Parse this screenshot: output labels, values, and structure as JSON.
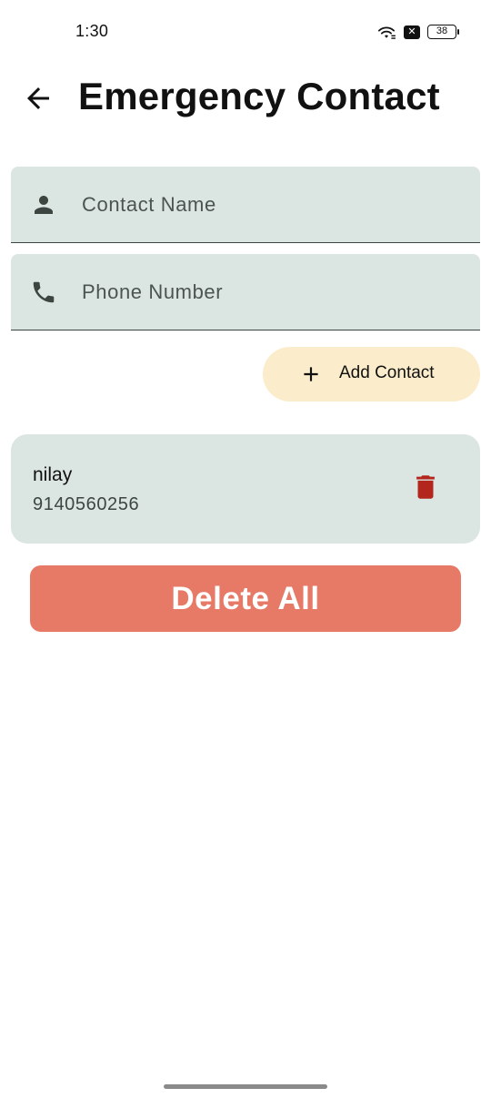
{
  "status_bar": {
    "time": "1:30",
    "battery": "38"
  },
  "header": {
    "title": "Emergency Contact",
    "back_icon": "arrow-back-icon"
  },
  "form": {
    "name_field": {
      "placeholder": "Contact Name",
      "value": "",
      "icon": "person-icon"
    },
    "phone_field": {
      "placeholder": "Phone Number",
      "value": "",
      "icon": "phone-icon"
    },
    "add_button": {
      "label": "Add Contact",
      "icon": "plus-icon"
    }
  },
  "contacts": [
    {
      "name": "nilay",
      "phone": "9140560256",
      "delete_icon": "trash-icon"
    }
  ],
  "actions": {
    "delete_all_label": "Delete All"
  },
  "colors": {
    "field_bg": "#dbe5e1",
    "add_button_bg": "#fbeccb",
    "delete_all_bg": "#e77a66",
    "trash_icon": "#b3261e"
  }
}
